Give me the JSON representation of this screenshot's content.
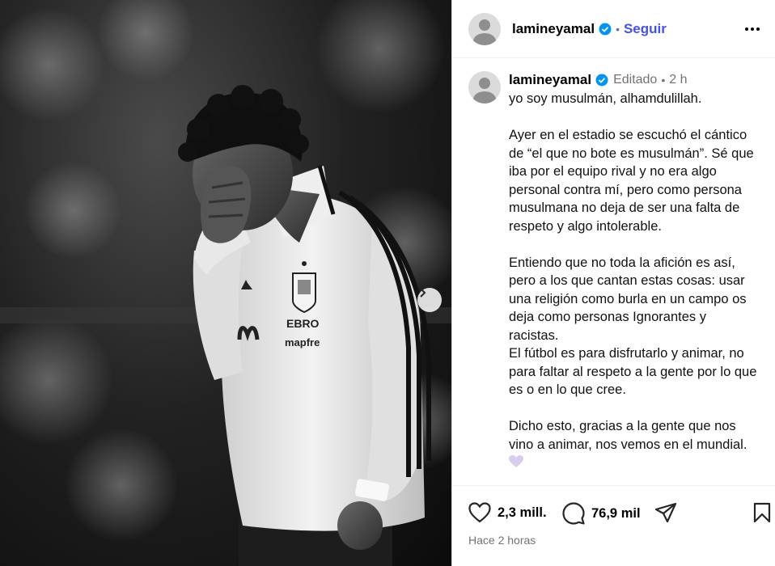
{
  "author": {
    "username": "lamineyamal",
    "follow_label": "Seguir",
    "dot": "•"
  },
  "caption": {
    "username": "lamineyamal",
    "edited_label": "Editado",
    "dot": "•",
    "time": "2 h",
    "text": "yo soy musulmán, alhamdulillah.\n\nAyer en el estadio se escuchó el cántico de “el que no bote es musulmán”. Sé que iba por el equipo rival y no era algo personal contra mí, pero como persona musulmana no deja de ser una falta de respeto y algo intolerable.\n\nEntiendo que no toda la afición es así, pero a los que cantan estas cosas: usar una religión como burla en un campo os deja como personas Ignorantes y racistas.\nEl fútbol es para disfrutarlo y animar, no para faltar al respeto a la gente por lo que es o en lo que cree.\n\nDicho esto, gracias a la gente que nos vino a animar, nos vemos en el mundial."
  },
  "stats": {
    "likes": "2,3 mill.",
    "comments": "76,9 mil"
  },
  "timestamp": "Hace 2 horas",
  "jersey_text": {
    "sponsor_top": "EBRO",
    "sponsor_bottom": "mapfre"
  },
  "colors": {
    "follow": "#4150f7",
    "verified": "#0095f6",
    "muted": "#737373",
    "heart_emoji": "#c9b8e8"
  },
  "icons": {
    "like": "heart-outline-icon",
    "comment": "speech-bubble-icon",
    "share": "paper-plane-icon",
    "save": "bookmark-icon",
    "more": "more-horizontal-icon",
    "next": "chevron-right-icon",
    "verified": "verified-badge-icon"
  }
}
